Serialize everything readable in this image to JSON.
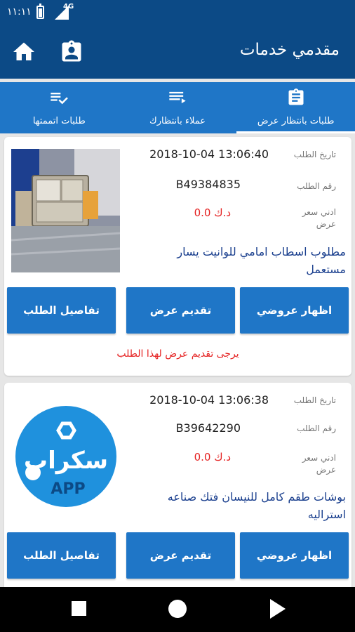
{
  "status_bar": {
    "time": "١١:١١",
    "network": "4G"
  },
  "app_bar": {
    "title": "مقدمي خدمات",
    "icons": [
      "home-icon",
      "contact-badge-icon"
    ]
  },
  "tabs": [
    {
      "label": "طلبات بانتظار عرض",
      "icon": "clipboard-icon",
      "selected": true
    },
    {
      "label": "عملاء بانتظارك",
      "icon": "playlist-play-icon",
      "selected": false
    },
    {
      "label": "طلبات اتممتها",
      "icon": "playlist-check-icon",
      "selected": false
    }
  ],
  "labels": {
    "date": "تاريخ الطلب",
    "number": "رقم الطلب",
    "price_line1": "ادني سعر",
    "price_line2": "عرض"
  },
  "orders": [
    {
      "date": "2018-10-04 13:06:40",
      "number": "B49384835",
      "price": "0.0 د.ك",
      "description": "مطلوب اسطاب امامي للوانيت يسار مستعمل",
      "buttons": {
        "show": "اظهار عروضي",
        "offer": "تقديم عرض",
        "details": "تفاصيل الطلب"
      },
      "note": "يرجى تقديم عرض لهذا الطلب"
    },
    {
      "date": "2018-10-04 13:06:38",
      "number": "B39642290",
      "price": "0.0 د.ك",
      "description": "بوشات طقم كامل للنيسان فتك صناعه استراليه",
      "logo": {
        "text": "سكراب",
        "sub": "APP"
      },
      "buttons": {
        "show": "اظهار عروضي",
        "offer": "تقديم عرض",
        "details": "تفاصيل الطلب"
      }
    }
  ],
  "colors": {
    "primary_dark": "#0c4a86",
    "primary": "#1f76c7",
    "price_red": "#e52222",
    "desc_blue": "#1a3f8e"
  },
  "nav": {
    "icons": [
      "recents-icon",
      "home-circle-icon",
      "back-icon"
    ]
  }
}
